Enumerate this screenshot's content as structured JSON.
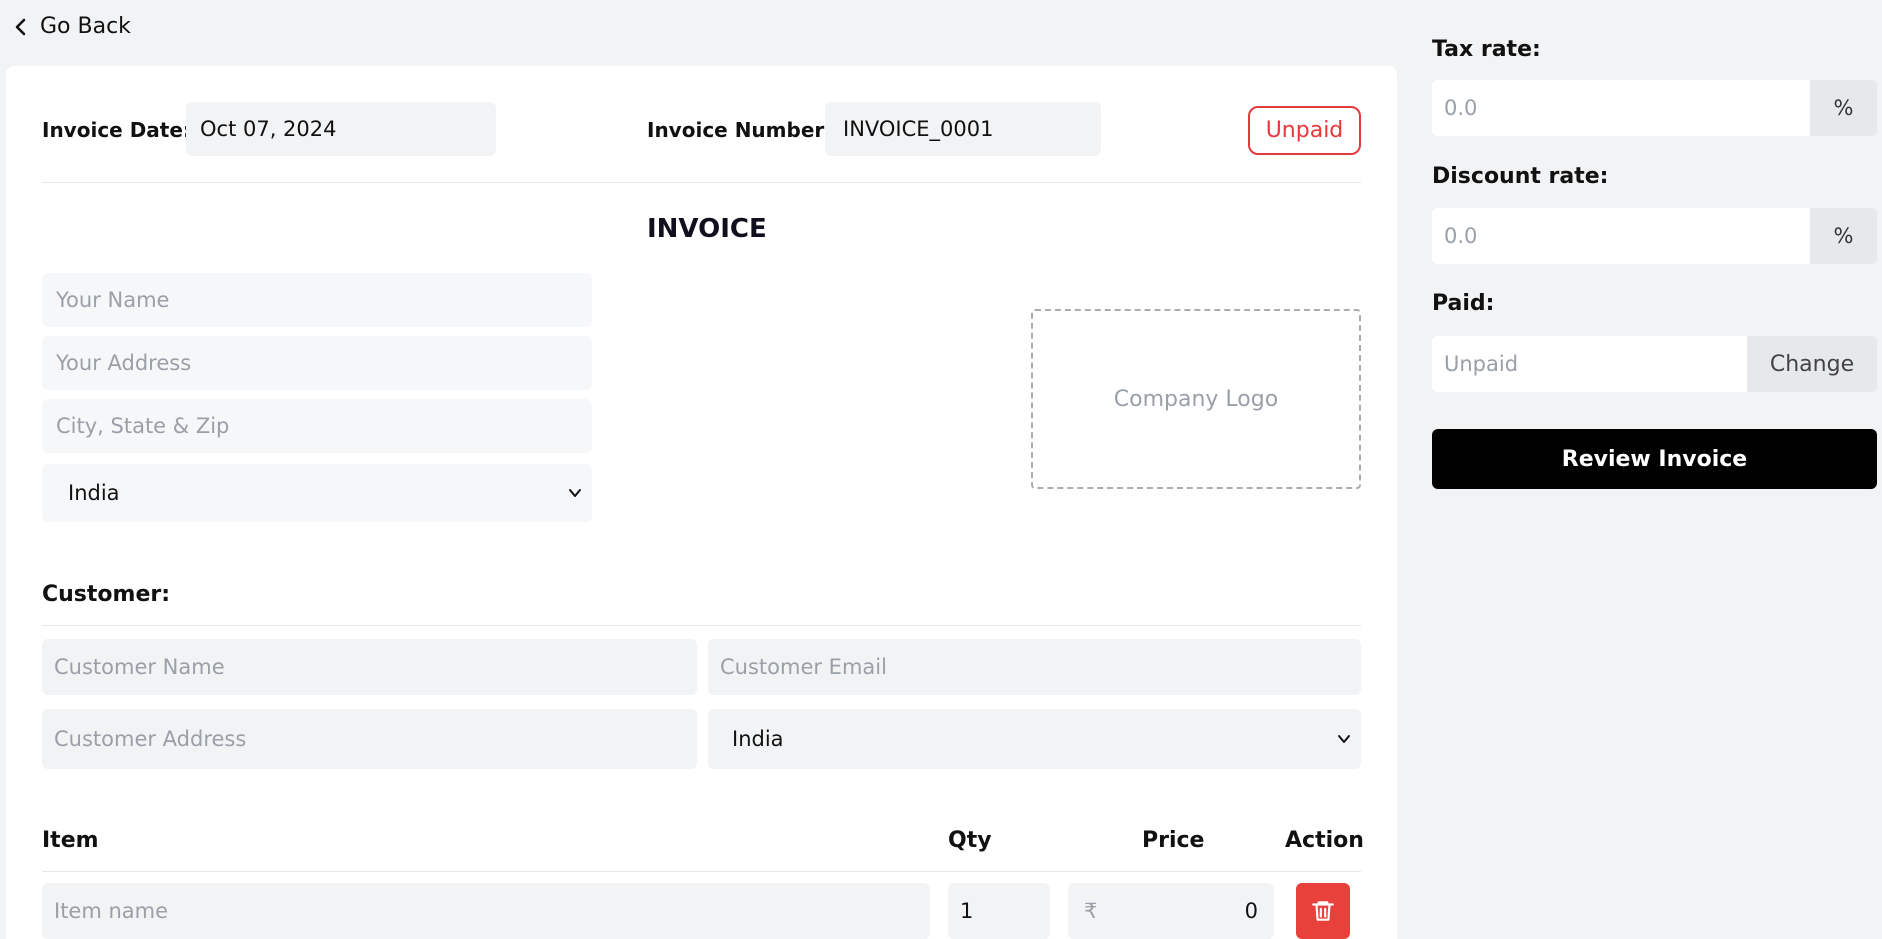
{
  "nav": {
    "back_label": "Go Back"
  },
  "header": {
    "invoice_date_label": "Invoice Date:",
    "invoice_date_value": "Oct 07, 2024",
    "invoice_number_label": "Invoice Number:",
    "invoice_number_value": "INVOICE_0001",
    "status_badge": "Unpaid"
  },
  "invoice_title": "INVOICE",
  "sender": {
    "name_placeholder": "Your Name",
    "address_placeholder": "Your Address",
    "city_placeholder": "City, State & Zip",
    "country_selected": "India"
  },
  "logo": {
    "label": "Company Logo"
  },
  "customer": {
    "section_label": "Customer:",
    "name_placeholder": "Customer Name",
    "email_placeholder": "Customer Email",
    "address_placeholder": "Customer Address",
    "country_selected": "India"
  },
  "items_table": {
    "columns": [
      "Item",
      "Qty",
      "Price",
      "Action"
    ],
    "rows": [
      {
        "item_placeholder": "Item name",
        "qty": "1",
        "currency_symbol": "₹",
        "price": "0"
      }
    ]
  },
  "sidebar": {
    "tax_label": "Tax rate:",
    "tax_placeholder": "0.0",
    "tax_addon": "%",
    "discount_label": "Discount rate:",
    "discount_placeholder": "0.0",
    "discount_addon": "%",
    "paid_label": "Paid:",
    "paid_placeholder": "Unpaid",
    "change_button": "Change",
    "review_button": "Review Invoice"
  },
  "colors": {
    "unpaid_red": "#e5393b",
    "delete_red": "#e8413b",
    "review_black": "#000000",
    "field_gray": "#f2f3f5"
  },
  "icons": {
    "back": "chevron-left-icon",
    "select": "chevron-down-icon",
    "delete": "trash-icon"
  }
}
